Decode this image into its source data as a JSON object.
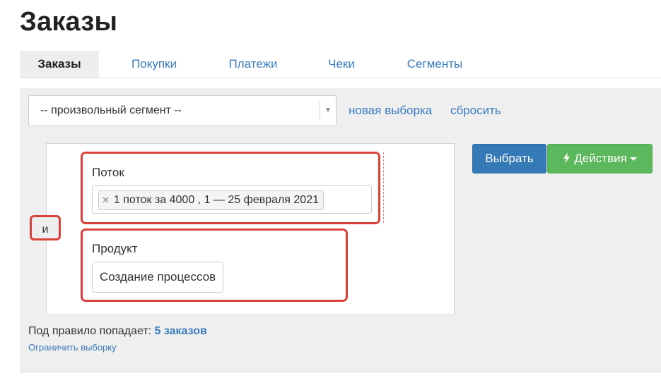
{
  "page": {
    "title": "Заказы"
  },
  "tabs": [
    {
      "label": "Заказы",
      "active": true
    },
    {
      "label": "Покупки",
      "active": false
    },
    {
      "label": "Платежи",
      "active": false
    },
    {
      "label": "Чеки",
      "active": false
    },
    {
      "label": "Сегменты",
      "active": false
    }
  ],
  "filter": {
    "segment_select_value": "-- произвольный сегмент --",
    "new_selection_link": "новая выборка",
    "reset_link": "сбросить"
  },
  "rules": {
    "operator_label": "и",
    "conditions": [
      {
        "title": "Поток",
        "tags": [
          "1 поток за 4000 , 1 — 25 февраля 2021"
        ]
      },
      {
        "title": "Продукт",
        "value": "Создание процессов"
      }
    ]
  },
  "actions": {
    "select_button": "Выбрать",
    "actions_button": "Действия"
  },
  "result": {
    "prefix": "Под правило попадает:",
    "count_text": "5 заказов",
    "limit_link": "Ограничить выборку"
  },
  "colors": {
    "link": "#3a7bbf",
    "primary": "#337ab7",
    "success": "#5cb85c",
    "highlight_border": "#d9423a"
  }
}
